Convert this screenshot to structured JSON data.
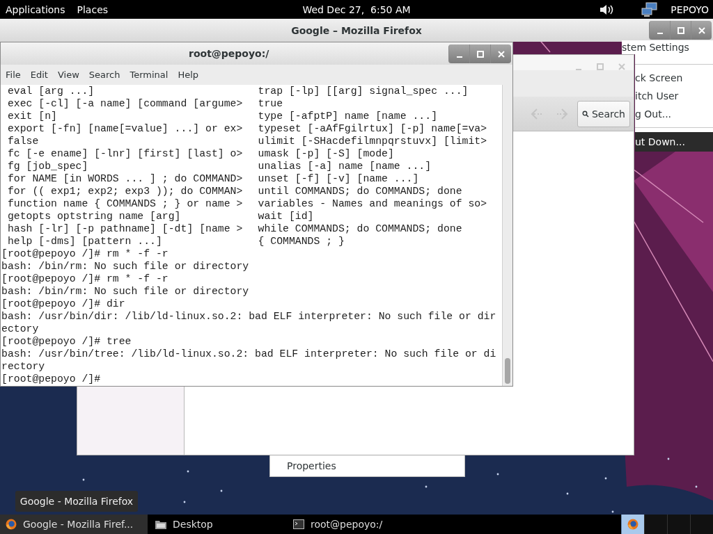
{
  "top_panel": {
    "menus": [
      "Applications",
      "Places"
    ],
    "clock": "Wed Dec 27,  6:50 AM",
    "user": "PEPOYO"
  },
  "firefox_window": {
    "title": "Google – Mozilla Firefox"
  },
  "system_menu": {
    "items": [
      {
        "label": "stem Settings",
        "selected": false,
        "separator_above": false
      },
      {
        "label": "ck Screen",
        "selected": false,
        "separator_above": true
      },
      {
        "label": "itch User",
        "selected": false,
        "separator_above": false
      },
      {
        "label": "g Out...",
        "selected": false,
        "separator_above": false
      },
      {
        "label": "ut Down...",
        "selected": true,
        "separator_above": true
      }
    ]
  },
  "file_window": {
    "search_button": "Search"
  },
  "terminal": {
    "title": "root@pepoyo:/",
    "menus": [
      "File",
      "Edit",
      "View",
      "Search",
      "Terminal",
      "Help"
    ],
    "help_rows": [
      {
        "left": "eval [arg ...]",
        "right": "trap [-lp] [[arg] signal_spec ...]"
      },
      {
        "left": "exec [-cl] [-a name] [command [argume>",
        "right": "true"
      },
      {
        "left": "exit [n]",
        "right": "type [-afptP] name [name ...]"
      },
      {
        "left": "export [-fn] [name[=value] ...] or ex>",
        "right": "typeset [-aAfFgilrtux] [-p] name[=va>"
      },
      {
        "left": "false",
        "right": "ulimit [-SHacdefilmnpqrstuvx] [limit>"
      },
      {
        "left": "fc [-e ename] [-lnr] [first] [last] o>",
        "right": "umask [-p] [-S] [mode]"
      },
      {
        "left": "fg [job_spec]",
        "right": "unalias [-a] name [name ...]"
      },
      {
        "left": "for NAME [in WORDS ... ] ; do COMMAND>",
        "right": "unset [-f] [-v] [name ...]"
      },
      {
        "left": "for (( exp1; exp2; exp3 )); do COMMAN>",
        "right": "until COMMANDS; do COMMANDS; done"
      },
      {
        "left": "function name { COMMANDS ; } or name >",
        "right": "variables - Names and meanings of so>"
      },
      {
        "left": "getopts optstring name [arg]",
        "right": "wait [id]"
      },
      {
        "left": "hash [-lr] [-p pathname] [-dt] [name >",
        "right": "while COMMANDS; do COMMANDS; done"
      },
      {
        "left": "help [-dms] [pattern ...]",
        "right": "{ COMMANDS ; }"
      }
    ],
    "lines": [
      "[root@pepoyo /]# rm * -f -r",
      "bash: /bin/rm: No such file or directory",
      "[root@pepoyo /]# rm * -f -r",
      "bash: /bin/rm: No such file or directory",
      "[root@pepoyo /]# dir",
      "bash: /usr/bin/dir: /lib/ld-linux.so.2: bad ELF interpreter: No such file or dir",
      "ectory",
      "[root@pepoyo /]# tree",
      "bash: /usr/bin/tree: /lib/ld-linux.so.2: bad ELF interpreter: No such file or di",
      "rectory",
      "[root@pepoyo /]#"
    ]
  },
  "context_menu": {
    "items": [
      "Properties"
    ]
  },
  "tooltip": "Google - Mozilla Firefox",
  "taskbar": {
    "tasks": [
      {
        "label": "Google - Mozilla Firef...",
        "kind": "firefox",
        "selected": true
      },
      {
        "label": "Desktop",
        "kind": "folder",
        "selected": false
      },
      {
        "label": "root@pepoyo:/",
        "kind": "terminal",
        "selected": false
      }
    ],
    "workspaces": [
      {
        "selected": true
      },
      {
        "selected": false
      },
      {
        "selected": false
      },
      {
        "selected": false
      }
    ]
  }
}
